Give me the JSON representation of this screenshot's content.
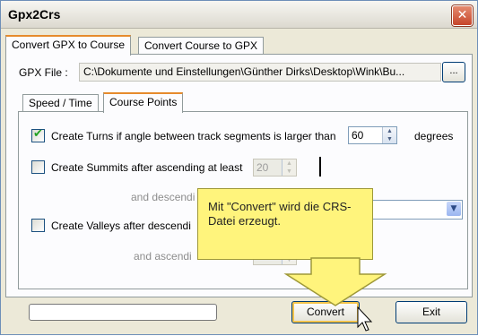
{
  "window": {
    "title": "Gpx2Crs",
    "close_glyph": "✕"
  },
  "tabs": [
    {
      "label": "Convert GPX to Course",
      "active": true
    },
    {
      "label": "Convert Course to GPX",
      "active": false
    }
  ],
  "gpx_file": {
    "label": "GPX File :",
    "path": "C:\\Dokumente und Einstellungen\\Günther Dirks\\Desktop\\Wink\\Bu...",
    "browse_label": "..."
  },
  "subtabs": [
    {
      "label": "Speed / Time",
      "active": false
    },
    {
      "label": "Course Points",
      "active": true
    }
  ],
  "turns": {
    "checked": true,
    "label": "Create Turns if angle between track segments is larger than",
    "value": "60",
    "unit": "degrees"
  },
  "summits": {
    "checked": false,
    "label": "Create Summits after ascending at least",
    "value": "20",
    "descending_label": "and descendi"
  },
  "valleys": {
    "checked": false,
    "label": "Create Valleys after descendi",
    "ascending_label": "and ascendi"
  },
  "callout": {
    "text": "Mit \"Convert\" wird die CRS-Datei erzeugt."
  },
  "buttons": {
    "convert": "Convert",
    "exit": "Exit"
  },
  "colors": {
    "callout": "#fff47c",
    "tab_accent": "#e68b2c",
    "check": "#21a121"
  }
}
